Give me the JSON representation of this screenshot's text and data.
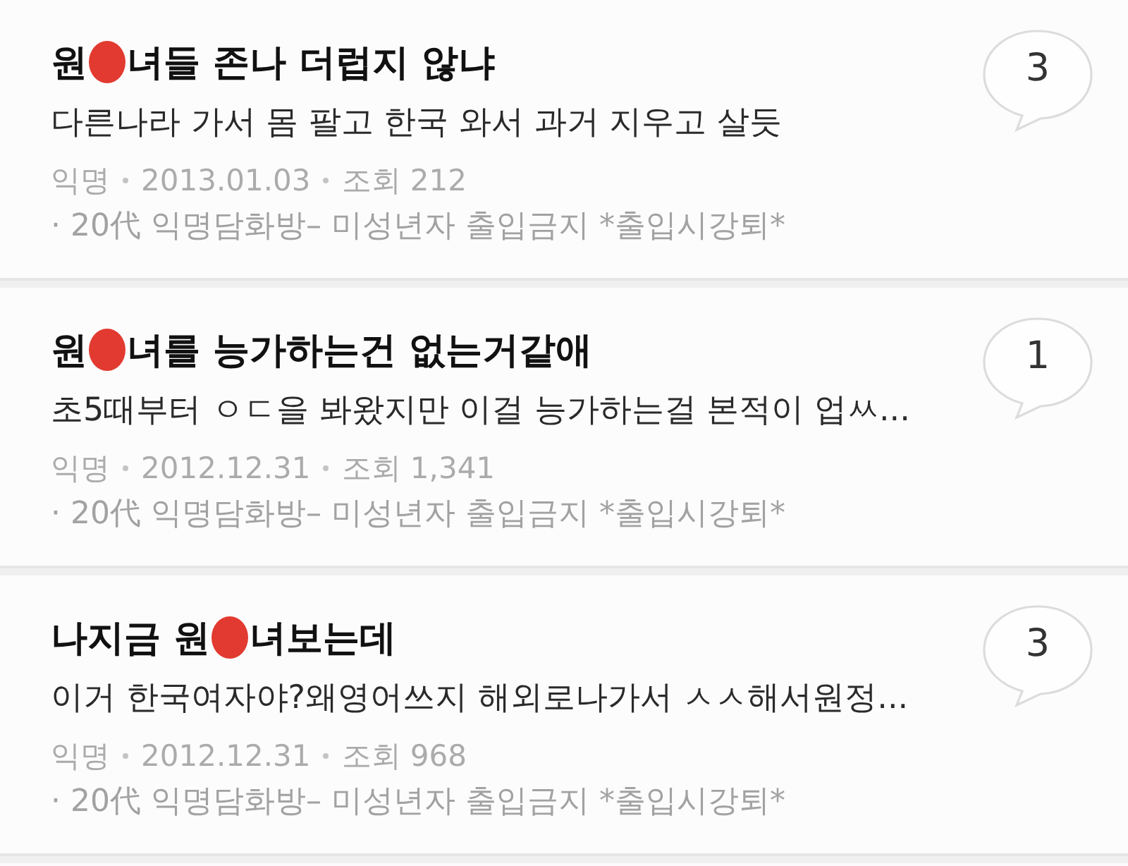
{
  "posts": [
    {
      "title_parts": [
        {
          "kind": "text",
          "text": "원"
        },
        {
          "kind": "redaction"
        },
        {
          "kind": "text",
          "text": "녀들 존나 더럽지 않냐"
        }
      ],
      "snippet": "다른나라 가서 몸 팔고 한국 와서 과거 지우고 살듯",
      "author": "익명",
      "date": "2013.01.03",
      "views": "조회 212",
      "board": "· 20代 익명담화방– 미성년자 출입금지 *출입시강퇴*",
      "comment_count": "3"
    },
    {
      "title_parts": [
        {
          "kind": "text",
          "text": "원"
        },
        {
          "kind": "redaction"
        },
        {
          "kind": "text",
          "text": "녀를 능가하는건 없는거같애"
        }
      ],
      "snippet": "초5때부터 ㅇㄷ을 봐왔지만 이걸 능가하는걸 본적이 업ㅆ...",
      "author": "익명",
      "date": "2012.12.31",
      "views": "조회 1,341",
      "board": "· 20代 익명담화방– 미성년자 출입금지 *출입시강퇴*",
      "comment_count": "1"
    },
    {
      "title_parts": [
        {
          "kind": "text",
          "text": "나지금 원"
        },
        {
          "kind": "redaction"
        },
        {
          "kind": "text",
          "text": "녀보는데"
        }
      ],
      "snippet": "이거 한국여자야?왜영어쓰지 해외로나가서 ㅅㅅ해서원정...",
      "author": "익명",
      "date": "2012.12.31",
      "views": "조회 968",
      "board": "· 20代 익명담화방– 미성년자 출입금지 *출입시강퇴*",
      "comment_count": "3"
    }
  ]
}
